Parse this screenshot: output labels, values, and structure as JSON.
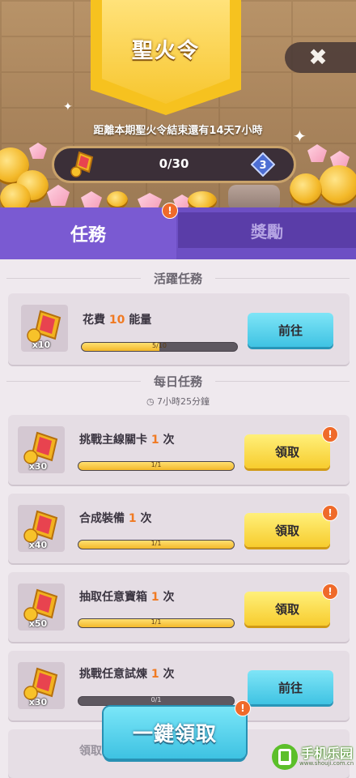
{
  "header": {
    "title": "聖火令",
    "close_icon": "close-x-icon",
    "countdown": "距離本期聖火令結束還有14天7小時",
    "progress": "0/30",
    "progress_value": 0,
    "progress_max": 30,
    "level": "3"
  },
  "tabs": [
    {
      "label": "任務",
      "active": true,
      "alert": "!"
    },
    {
      "label": "獎勵",
      "active": false
    }
  ],
  "active_section": {
    "title": "活躍任務",
    "tasks": [
      {
        "text_pre": "花費 ",
        "num": "10",
        "text_post": " 能量",
        "reward_qty": "x10",
        "progress": "5/10",
        "fill": 0.5,
        "button": "前往",
        "button_type": "blue",
        "alert": ""
      }
    ]
  },
  "daily_section": {
    "title": "每日任務",
    "timer": "7小時25分鐘",
    "tasks": [
      {
        "text_pre": "挑戰主線關卡 ",
        "num": "1",
        "text_post": " 次",
        "reward_qty": "x30",
        "progress": "1/1",
        "fill": 1,
        "button": "領取",
        "button_type": "yellow",
        "alert": "!"
      },
      {
        "text_pre": "合成裝備 ",
        "num": "1",
        "text_post": " 次",
        "reward_qty": "x40",
        "progress": "1/1",
        "fill": 1,
        "button": "領取",
        "button_type": "yellow",
        "alert": "!"
      },
      {
        "text_pre": "抽取任意寶箱 ",
        "num": "1",
        "text_post": " 次",
        "reward_qty": "x50",
        "progress": "1/1",
        "fill": 1,
        "button": "領取",
        "button_type": "yellow",
        "alert": "!"
      },
      {
        "text_pre": "挑戰任意試煉 ",
        "num": "1",
        "text_post": " 次",
        "reward_qty": "x30",
        "progress": "0/1",
        "fill": 0,
        "button": "前往",
        "button_type": "blue",
        "alert": ""
      }
    ],
    "partial_next": "領取"
  },
  "claim_all": {
    "label": "一鍵領取",
    "alert": "!"
  },
  "watermark": {
    "text": "手机乐园",
    "sub": "www.shouji.com.cn"
  },
  "colors": {
    "tab_active": "#7a5ad2",
    "tab_inactive": "#5a3da8",
    "accent_orange": "#f07a22",
    "button_blue": "#3fc3e3",
    "button_yellow": "#f7cc2e"
  }
}
